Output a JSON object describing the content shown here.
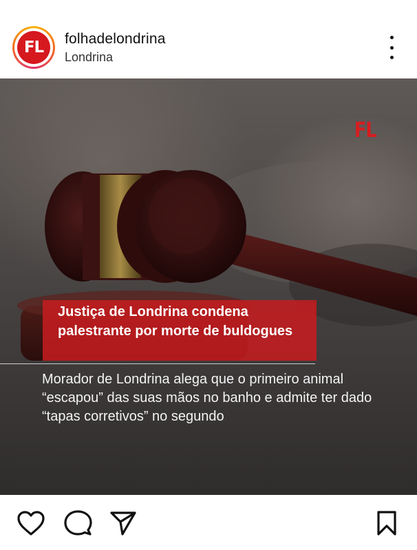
{
  "header": {
    "avatar_text": "FL",
    "username": "folhadelondrina",
    "location": "Londrina",
    "more_icon": "more-options-icon"
  },
  "post": {
    "watermark": "FL",
    "headline": "Justiça de Londrina condena palestrante por morte de buldogues",
    "subtitle": "Morador de Londrina alega que o primeiro animal “escapou” das suas mãos no banho e admite ter dado “tapas corretivos” no segundo",
    "brand_color": "#d6181f"
  },
  "actions": {
    "like_icon": "heart-icon",
    "comment_icon": "comment-icon",
    "share_icon": "share-icon",
    "save_icon": "bookmark-icon"
  }
}
